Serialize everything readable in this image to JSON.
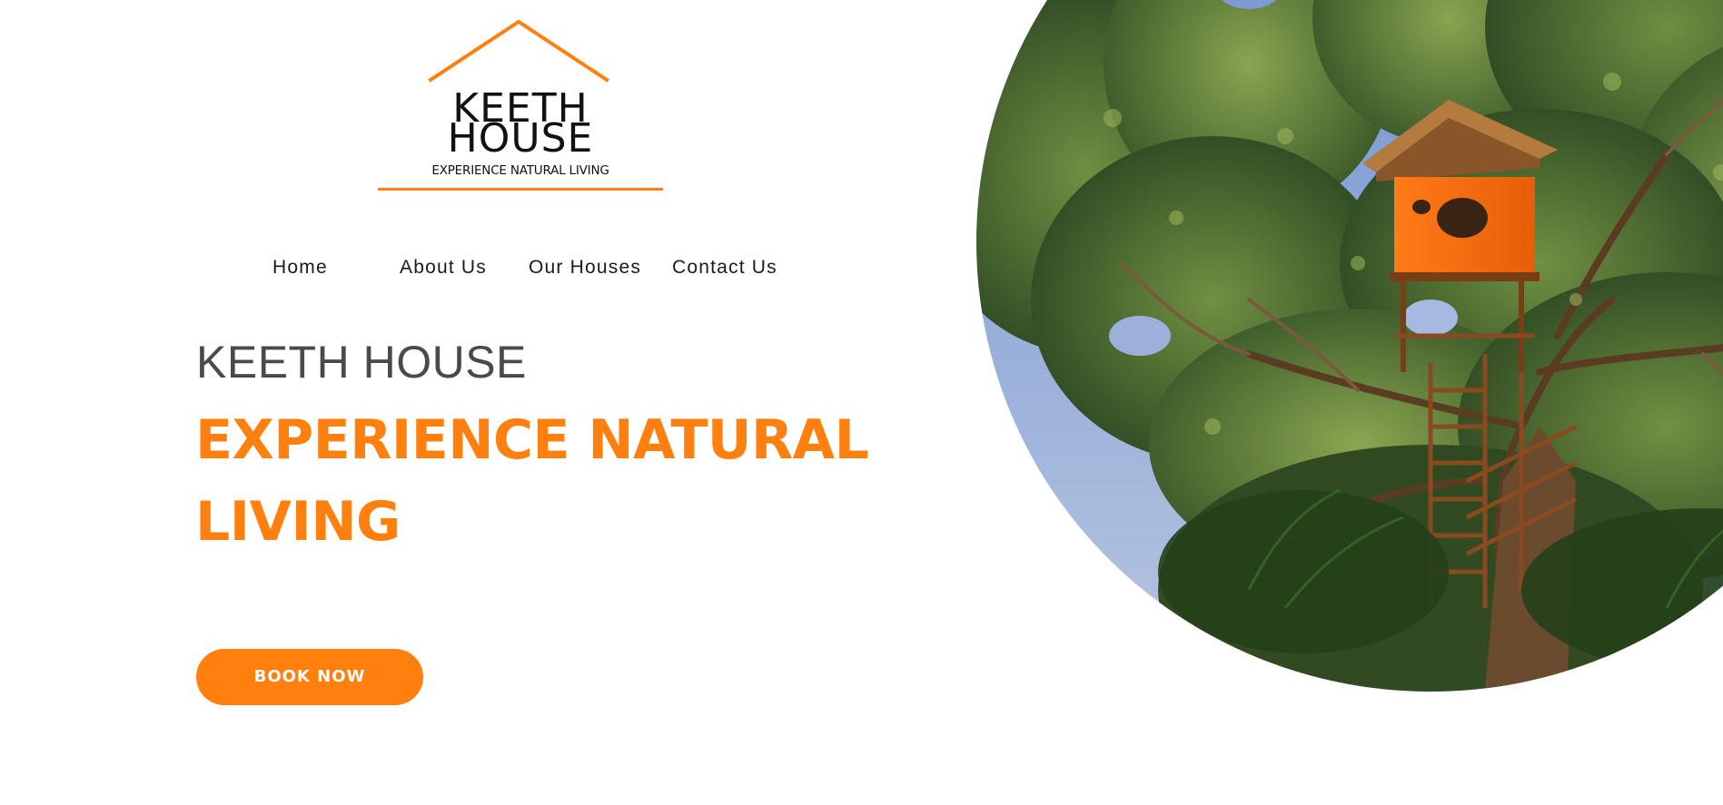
{
  "brand": {
    "name_line1": "KEETH",
    "name_line2": "HOUSE",
    "tagline": "EXPERIENCE NATURAL LIVING",
    "accent_color": "#ff7f0f"
  },
  "nav": {
    "items": [
      {
        "label": "Home"
      },
      {
        "label": "About Us"
      },
      {
        "label": "Our Houses"
      },
      {
        "label": "Contact Us"
      }
    ]
  },
  "hero": {
    "kicker": "KEETH HOUSE",
    "headline": "EXPERIENCE NATURAL LIVING",
    "cta_label": "BOOK NOW",
    "image_description_icon": "treehouse-photo"
  }
}
